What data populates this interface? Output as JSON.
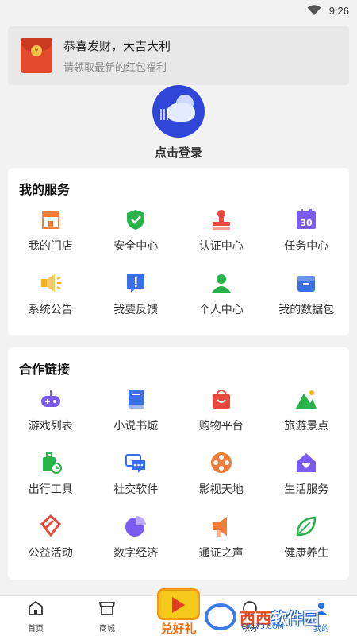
{
  "status": {
    "time": "9:26"
  },
  "banner": {
    "title": "恭喜发财，大吉大利",
    "subtitle": "请领取最新的红包福利",
    "coin": "¥"
  },
  "profile": {
    "login_label": "点击登录"
  },
  "services": {
    "title": "我的服务",
    "items": [
      {
        "label": "我的门店",
        "icon": "store-icon",
        "color": "#f07c3a"
      },
      {
        "label": "安全中心",
        "icon": "shield-check-icon",
        "color": "#27b34a"
      },
      {
        "label": "认证中心",
        "icon": "stamp-icon",
        "color": "#e64a3c"
      },
      {
        "label": "任务中心",
        "icon": "calendar-30-icon",
        "color": "#7b5cf0",
        "text": "30"
      },
      {
        "label": "系统公告",
        "icon": "megaphone-icon",
        "color": "#f5b21e"
      },
      {
        "label": "我要反馈",
        "icon": "feedback-icon",
        "color": "#3a6fe8"
      },
      {
        "label": "个人中心",
        "icon": "person-icon",
        "color": "#27b34a"
      },
      {
        "label": "我的数据包",
        "icon": "data-package-icon",
        "color": "#3a6fe8"
      }
    ]
  },
  "partners": {
    "title": "合作链接",
    "items": [
      {
        "label": "游戏列表",
        "icon": "gamepad-icon",
        "color": "#7b5cf0"
      },
      {
        "label": "小说书城",
        "icon": "book-icon",
        "color": "#3a6fe8"
      },
      {
        "label": "购物平台",
        "icon": "shopping-bag-icon",
        "color": "#e64a3c"
      },
      {
        "label": "旅游景点",
        "icon": "mountain-icon",
        "color": "#27b34a"
      },
      {
        "label": "出行工具",
        "icon": "luggage-icon",
        "color": "#27b34a"
      },
      {
        "label": "社交软件",
        "icon": "chat-icon",
        "color": "#3a6fe8"
      },
      {
        "label": "影视天地",
        "icon": "film-reel-icon",
        "color": "#f07c3a"
      },
      {
        "label": "生活服务",
        "icon": "home-heart-icon",
        "color": "#7b5cf0"
      },
      {
        "label": "公益活动",
        "icon": "heart-hands-icon",
        "color": "#e64a3c"
      },
      {
        "label": "数字经济",
        "icon": "pie-chart-icon",
        "color": "#7b5cf0"
      },
      {
        "label": "通证之声",
        "icon": "loudspeaker-icon",
        "color": "#f07c3a"
      },
      {
        "label": "健康养生",
        "icon": "leaf-icon",
        "color": "#27b34a"
      }
    ]
  },
  "tabs": [
    {
      "label": "首页",
      "icon": "home-icon",
      "active": false
    },
    {
      "label": "商城",
      "icon": "shop-icon",
      "active": false
    },
    {
      "label": "",
      "icon": "promo-icon",
      "active": false
    },
    {
      "label": "积分",
      "icon": "points-icon",
      "active": false
    },
    {
      "label": "我的",
      "icon": "profile-icon",
      "active": true
    }
  ],
  "promo": {
    "label": "兑好礼"
  },
  "watermark": {
    "name_a": "西西",
    "name_b": "软件园",
    "domain": "CR173.COM"
  },
  "colors": {
    "accent": "#1e6fe8",
    "background": "#f2f2f2"
  }
}
